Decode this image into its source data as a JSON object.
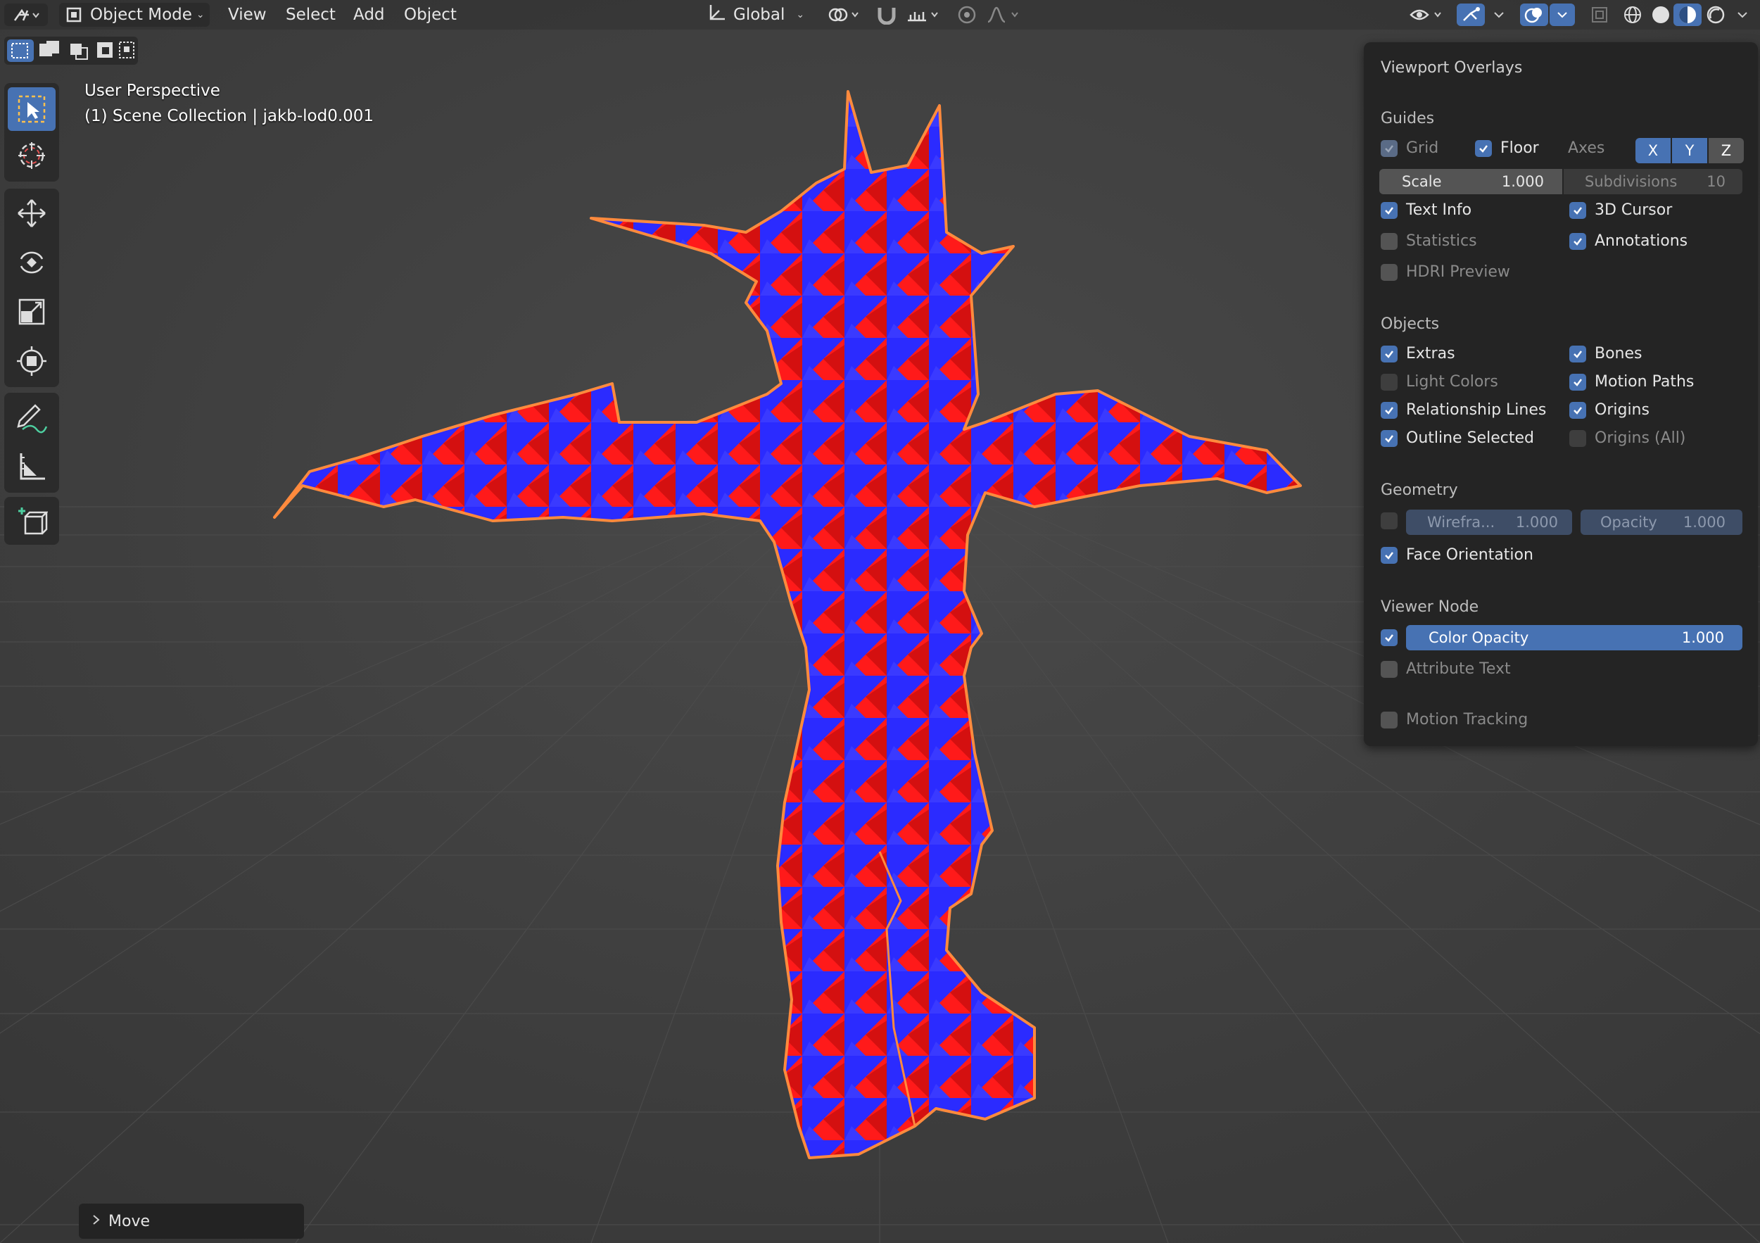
{
  "header": {
    "mode_label": "Object Mode",
    "menus": [
      "View",
      "Select",
      "Add",
      "Object"
    ],
    "orientation_label": "Global"
  },
  "viewport": {
    "perspective_label": "User Perspective",
    "collection_label": "(1) Scene Collection | jakb-lod0.001",
    "mesh_colors": {
      "front": "#ff1a1a",
      "back": "#2b2bff",
      "outline": "#ff8a3d"
    }
  },
  "last_operator": {
    "label": "Move"
  },
  "overlays_panel": {
    "title": "Viewport Overlays",
    "guides": {
      "heading": "Guides",
      "grid": {
        "label": "Grid",
        "checked": true
      },
      "floor": {
        "label": "Floor",
        "checked": true
      },
      "axes": {
        "label": "Axes",
        "x": "X",
        "y": "Y",
        "z": "Z"
      },
      "scale": {
        "label": "Scale",
        "value": "1.000"
      },
      "subdivisions": {
        "label": "Subdivisions",
        "value": "10"
      },
      "text_info": {
        "label": "Text Info",
        "checked": true
      },
      "cursor3d": {
        "label": "3D Cursor",
        "checked": true
      },
      "statistics": {
        "label": "Statistics",
        "checked": false
      },
      "annotations": {
        "label": "Annotations",
        "checked": true
      },
      "hdri_preview": {
        "label": "HDRI Preview",
        "checked": false
      }
    },
    "objects": {
      "heading": "Objects",
      "extras": {
        "label": "Extras",
        "checked": true
      },
      "bones": {
        "label": "Bones",
        "checked": true
      },
      "light_colors": {
        "label": "Light Colors",
        "checked": false
      },
      "motion_paths": {
        "label": "Motion Paths",
        "checked": true
      },
      "relationship_lines": {
        "label": "Relationship Lines",
        "checked": true
      },
      "origins": {
        "label": "Origins",
        "checked": true
      },
      "outline_selected": {
        "label": "Outline Selected",
        "checked": true
      },
      "origins_all": {
        "label": "Origins (All)",
        "checked": false
      }
    },
    "geometry": {
      "heading": "Geometry",
      "wireframe": {
        "label": "Wirefra...",
        "value": "1.000",
        "checked": false
      },
      "opacity": {
        "label": "Opacity",
        "value": "1.000"
      },
      "face_orientation": {
        "label": "Face Orientation",
        "checked": true
      }
    },
    "viewer_node": {
      "heading": "Viewer Node",
      "color_opacity": {
        "label": "Color Opacity",
        "value": "1.000",
        "checked": true
      },
      "attribute_text": {
        "label": "Attribute Text",
        "checked": false
      }
    },
    "motion_tracking": {
      "label": "Motion Tracking",
      "checked": false
    }
  }
}
